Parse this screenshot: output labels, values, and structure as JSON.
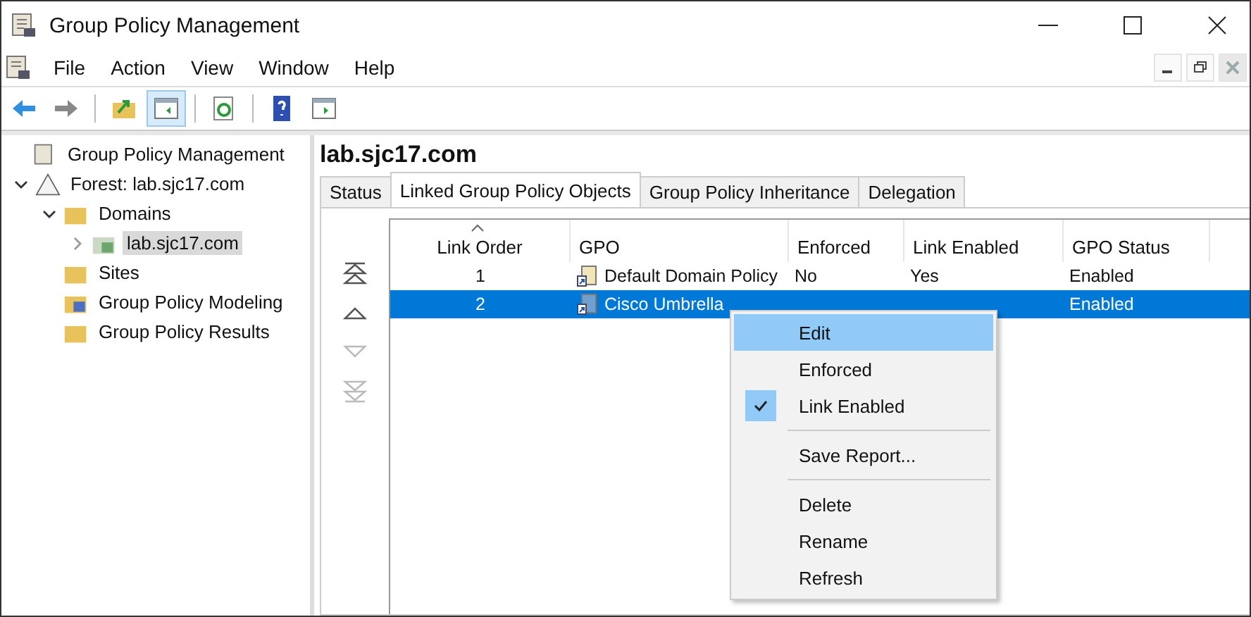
{
  "window": {
    "title": "Group Policy Management"
  },
  "menu": [
    "File",
    "Action",
    "View",
    "Window",
    "Help"
  ],
  "toolbar": [
    {
      "kind": "back",
      "selected": false
    },
    {
      "kind": "forward",
      "selected": false
    },
    {
      "kind": "sep"
    },
    {
      "kind": "up",
      "selected": false
    },
    {
      "kind": "pane",
      "selected": true
    },
    {
      "kind": "sep"
    },
    {
      "kind": "refresh",
      "selected": false
    },
    {
      "kind": "sep"
    },
    {
      "kind": "help",
      "selected": false
    },
    {
      "kind": "action",
      "selected": false
    }
  ],
  "tree": [
    {
      "label": "Group Policy Management",
      "kind": "console",
      "selected": false,
      "children": [
        {
          "label": "Forest: lab.sjc17.com",
          "kind": "forest",
          "expanded": true,
          "selected": false,
          "children": [
            {
              "label": "Domains",
              "kind": "domains",
              "expanded": true,
              "selected": false,
              "children": [
                {
                  "label": "lab.sjc17.com",
                  "kind": "domain",
                  "expanded": false,
                  "selected": true
                }
              ]
            },
            {
              "label": "Sites",
              "kind": "sites",
              "selected": false
            },
            {
              "label": "Group Policy Modeling",
              "kind": "modeling",
              "selected": false
            },
            {
              "label": "Group Policy Results",
              "kind": "results",
              "selected": false
            }
          ]
        }
      ]
    }
  ],
  "heading": "lab.sjc17.com",
  "tabs": [
    {
      "label": "Status",
      "selected": false
    },
    {
      "label": "Linked Group Policy Objects",
      "selected": true
    },
    {
      "label": "Group Policy Inheritance",
      "selected": false
    },
    {
      "label": "Delegation",
      "selected": false
    }
  ],
  "move_buttons": [
    {
      "kind": "top",
      "disabled": false
    },
    {
      "kind": "up",
      "disabled": false
    },
    {
      "kind": "down",
      "disabled": true
    },
    {
      "kind": "bottom",
      "disabled": true
    }
  ],
  "table": {
    "columns": [
      {
        "label": "Link Order",
        "sorted": true
      },
      {
        "label": "GPO",
        "sorted": false
      },
      {
        "label": "Enforced",
        "sorted": false
      },
      {
        "label": "Link Enabled",
        "sorted": false
      },
      {
        "label": "GPO Status",
        "sorted": false
      }
    ],
    "rows": [
      {
        "order": "1",
        "gpo": "Default Domain Policy",
        "enforced": "No",
        "link_enabled": "Yes",
        "status": "Enabled",
        "selected": false
      },
      {
        "order": "2",
        "gpo": "Cisco Umbrella",
        "status": "Enabled",
        "selected": true
      }
    ]
  },
  "context_menu": [
    {
      "kind": "item",
      "label": "Edit",
      "selected": true,
      "checked": false
    },
    {
      "kind": "item",
      "label": "Enforced",
      "selected": false,
      "checked": false
    },
    {
      "kind": "item",
      "label": "Link Enabled",
      "selected": false,
      "checked": true
    },
    {
      "kind": "separator"
    },
    {
      "kind": "item",
      "label": "Save Report...",
      "selected": false,
      "checked": false
    },
    {
      "kind": "separator"
    },
    {
      "kind": "item",
      "label": "Delete",
      "selected": false,
      "checked": false
    },
    {
      "kind": "item",
      "label": "Rename",
      "selected": false,
      "checked": false
    },
    {
      "kind": "item",
      "label": "Refresh",
      "selected": false,
      "checked": false
    }
  ]
}
